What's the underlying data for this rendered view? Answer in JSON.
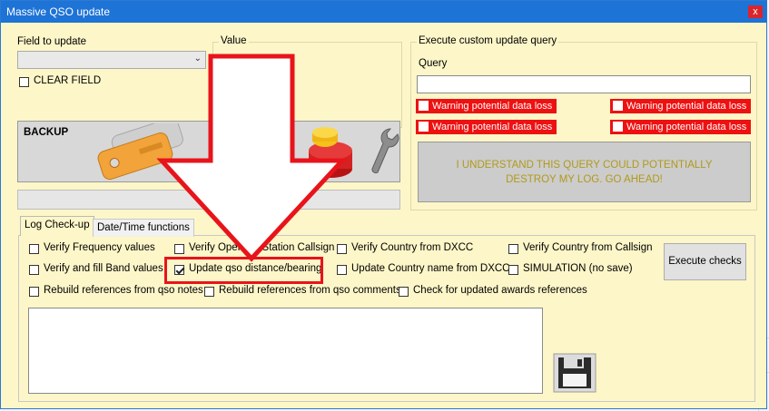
{
  "window": {
    "title": "Massive QSO update",
    "close_glyph": "x"
  },
  "field_update": {
    "label": "Field to update",
    "selected": "",
    "clear_field_label": "CLEAR FIELD",
    "clear_field_checked": false
  },
  "value_group": {
    "title": "Value"
  },
  "backup": {
    "label": "BACKUP"
  },
  "custom_query": {
    "title": "Execute custom update query",
    "query_label": "Query",
    "query_value": "",
    "warnings": [
      "Warning potential data loss",
      "Warning potential data loss",
      "Warning potential data loss",
      "Warning potential data loss"
    ],
    "execute_label": "I UNDERSTAND THIS QUERY COULD POTENTIALLY DESTROY MY LOG. GO AHEAD!"
  },
  "tabs": [
    {
      "label": "Log Check-up",
      "active": true
    },
    {
      "label": "Date/Time functions",
      "active": false
    }
  ],
  "checks": {
    "row1": [
      {
        "label": "Verify Frequency values",
        "checked": false
      },
      {
        "label": "Verify Operator/Station Callsign",
        "checked": false
      },
      {
        "label": "Verify Country from DXCC",
        "checked": false
      },
      {
        "label": "Verify Country from Callsign",
        "checked": false
      }
    ],
    "row2": [
      {
        "label": "Verify and fill Band values",
        "checked": false
      },
      {
        "label": "Update qso distance/bearing",
        "checked": true
      },
      {
        "label": "Update Country name from DXCC",
        "checked": false
      },
      {
        "label": "SIMULATION (no save)",
        "checked": false
      }
    ],
    "row3": [
      {
        "label": "Rebuild references from qso notes",
        "checked": false
      },
      {
        "label": "Rebuild references from qso comments",
        "checked": false
      },
      {
        "label": "Check for updated awards references",
        "checked": false
      }
    ]
  },
  "execute_checks_label": "Execute checks",
  "log_text": "",
  "colors": {
    "window_bg": "#fdf6c8",
    "titlebar": "#1e73d6",
    "warning": "#ee1111",
    "highlight": "#e8141b"
  },
  "icons": {
    "backup_keys": "keys-icon",
    "database": "database-icon",
    "wrench": "wrench-icon",
    "save": "floppy-disk-icon",
    "annotation_arrow": "arrow-down-icon"
  }
}
